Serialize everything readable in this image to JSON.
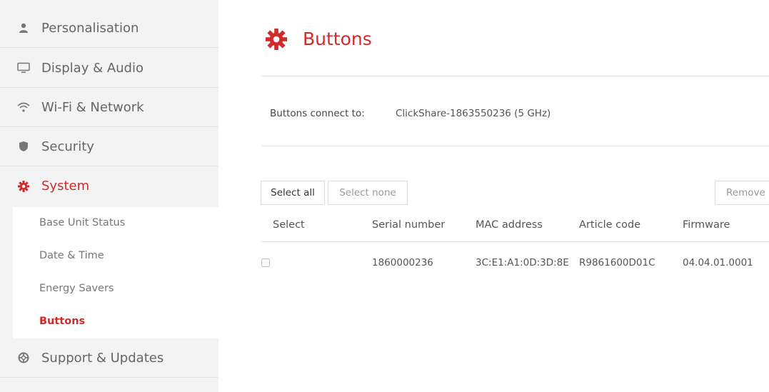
{
  "sidebar": {
    "items": [
      {
        "label": "Personalisation",
        "icon": "person-icon"
      },
      {
        "label": "Display & Audio",
        "icon": "monitor-icon"
      },
      {
        "label": "Wi-Fi & Network",
        "icon": "wifi-icon"
      },
      {
        "label": "Security",
        "icon": "shield-icon"
      },
      {
        "label": "System",
        "icon": "gear-icon"
      },
      {
        "label": "Support & Updates",
        "icon": "lifebuoy-icon"
      }
    ],
    "sub_items": [
      {
        "label": "Base Unit Status"
      },
      {
        "label": "Date & Time"
      },
      {
        "label": "Energy Savers"
      },
      {
        "label": "Buttons"
      }
    ]
  },
  "main": {
    "title": "Buttons",
    "connect_label": "Buttons connect to:",
    "connect_value": "ClickShare-1863550236 (5 GHz)",
    "actions": {
      "select_all": "Select all",
      "select_none": "Select none",
      "remove": "Remove"
    },
    "table": {
      "headers": [
        "Select",
        "Serial number",
        "MAC address",
        "Article code",
        "Firmware"
      ],
      "rows": [
        {
          "serial": "1860000236",
          "mac": "3C:E1:A1:0D:3D:8E",
          "article": "R9861600D01C",
          "firmware": "04.04.01.0001"
        }
      ]
    }
  },
  "colors": {
    "accent": "#d22a2a",
    "sidebar_bg": "#f3f3f3"
  }
}
